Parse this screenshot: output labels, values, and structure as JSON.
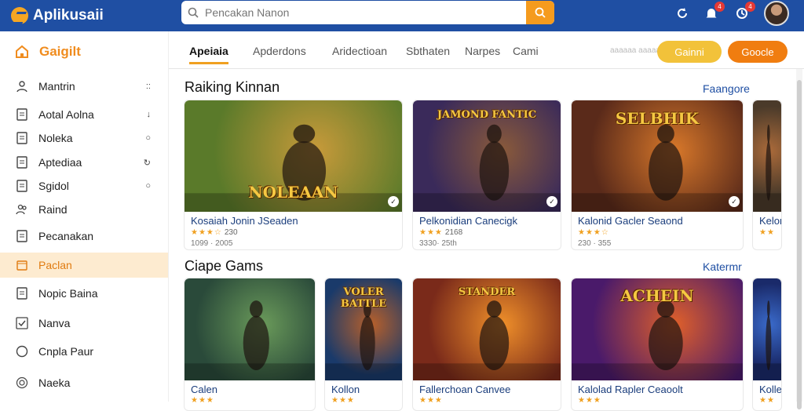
{
  "app": {
    "title": "Aplikusaii"
  },
  "search": {
    "placeholder": "Pencakan Nanon",
    "value": ""
  },
  "header": {
    "badge_1": "4",
    "badge_2": "4"
  },
  "sidebar": {
    "heading": "Gaigilt",
    "items": [
      {
        "label": "Mantrin",
        "tail": "::",
        "icon": "user-icon"
      },
      {
        "label": "Aotal Aolna",
        "tail": "↓",
        "icon": "doc-icon"
      },
      {
        "label": "Noleka",
        "tail": "○",
        "icon": "doc-icon"
      },
      {
        "label": "Aptediaa",
        "tail": "↻",
        "icon": "doc-icon"
      },
      {
        "label": "Sgidol",
        "tail": "○",
        "icon": "doc-icon"
      },
      {
        "label": "Raind",
        "tail": "",
        "icon": "people-icon"
      },
      {
        "label": "Pecanakan",
        "tail": "",
        "icon": "doc-icon"
      },
      {
        "label": "Paclan",
        "tail": "",
        "icon": "calendar-icon"
      },
      {
        "label": "Nopic Baina",
        "tail": "",
        "icon": "doc-icon"
      },
      {
        "label": "Nanva",
        "tail": "",
        "icon": "check-icon"
      },
      {
        "label": "Cnpla Paur",
        "tail": "",
        "icon": "circle-icon"
      },
      {
        "label": "Naeka",
        "tail": "",
        "icon": "coin-icon"
      }
    ]
  },
  "tabs": [
    "Apeiaia",
    "Apderdons",
    "Aridectioan",
    "Sbthaten",
    "Narpes",
    "Cami"
  ],
  "tabs_faint": "aaaaaa aaaaa",
  "buttons": {
    "primary": "Gainni",
    "secondary": "Goocle"
  },
  "section1": {
    "title": "Raiking Kinnan",
    "link": "Faangore"
  },
  "section2": {
    "title": "Ciape Gams",
    "link": "Katermr"
  },
  "cards_row1": [
    {
      "art_text": "NOLEAAN",
      "title": "Kosaiah Jonin JSeaden",
      "stars": "★★★☆",
      "rating": "230",
      "meta": "1099 · 2005",
      "color_a": "#5a7a2a",
      "color_b": "#c89a3a"
    },
    {
      "art_text": "JAMOND FANTIC",
      "title": "Pelkonidian Canecigk",
      "stars": "★★★",
      "rating": "2168",
      "meta": "3330· 25th",
      "color_a": "#3a2a5a",
      "color_b": "#8a5a3a"
    },
    {
      "art_text": "SELBHIK",
      "title": "Kalonid Gacler Seaond",
      "stars": "★★★☆",
      "rating": "",
      "meta": "230 · 355",
      "color_a": "#5a2a1a",
      "color_b": "#d8782a"
    },
    {
      "art_text": "",
      "title": "Kelon",
      "stars": "★★",
      "rating": "",
      "meta": "",
      "color_a": "#4a3a2a",
      "color_b": "#aa6a3a"
    }
  ],
  "cards_row2": [
    {
      "art_text": "",
      "title": "Calen",
      "stars": "★★★",
      "color_a": "#2a4a3a",
      "color_b": "#6a9a5a"
    },
    {
      "art_text": "VOLER BATTLE",
      "title": "Kollon",
      "stars": "★★★",
      "color_a": "#1a3a6a",
      "color_b": "#b8602a"
    },
    {
      "art_text": "STANDER",
      "title": "Fallerchoan Canvee",
      "stars": "★★★",
      "color_a": "#7a2a1a",
      "color_b": "#f0902a"
    },
    {
      "art_text": "ACHEIN",
      "title": "Kalolad Rapler Ceaoolt",
      "stars": "★★★",
      "color_a": "#4a1a6a",
      "color_b": "#e0602a"
    },
    {
      "art_text": "",
      "title": "Kolle",
      "stars": "★★",
      "color_a": "#1a2a6a",
      "color_b": "#3a6aca"
    }
  ],
  "colors": {
    "topbar": "#1f4fa3",
    "accent": "#f08c1e",
    "link": "#1f4fa3",
    "active_bg": "#fdebd0"
  }
}
